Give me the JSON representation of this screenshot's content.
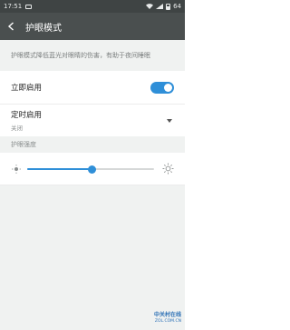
{
  "status_bar": {
    "time": "17:51",
    "battery_level": "64",
    "icons": [
      "image-icon",
      "wifi-icon",
      "signal-icon",
      "battery-icon"
    ]
  },
  "toolbar": {
    "title": "护眼模式",
    "back_icon": "back-chevron-icon"
  },
  "description": "护眼模式降低蓝光对眼睛的伤害，有助于夜间睡眠",
  "settings": {
    "enable_now": {
      "label": "立即启用",
      "enabled": true
    },
    "schedule": {
      "label": "定时启用",
      "value": "关闭"
    }
  },
  "brightness": {
    "header": "护眼强度",
    "level_percent": 51
  },
  "watermark": {
    "main": "中关村在线",
    "sub": "ZOL.COM.CN"
  },
  "colors": {
    "accent": "#2f8fd8",
    "toolbar": "#4a4f4f",
    "status_bar": "#3f4444",
    "background": "#f0f2f1"
  }
}
